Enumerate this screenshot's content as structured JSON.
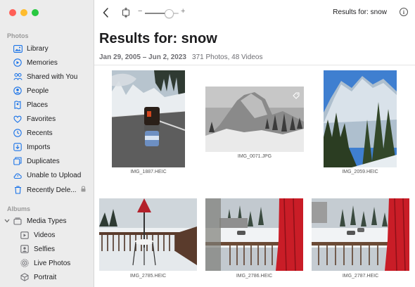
{
  "window_controls": {
    "close_color": "#ff5f57",
    "min_color": "#febc2e",
    "zoom_color": "#28c840"
  },
  "sidebar": {
    "photos_section": "Photos",
    "items": [
      {
        "label": "Library",
        "icon": "photo-library-icon"
      },
      {
        "label": "Memories",
        "icon": "memories-icon"
      },
      {
        "label": "Shared with You",
        "icon": "shared-with-you-icon"
      },
      {
        "label": "People",
        "icon": "people-icon"
      },
      {
        "label": "Places",
        "icon": "places-pin-icon"
      },
      {
        "label": "Favorites",
        "icon": "heart-icon"
      },
      {
        "label": "Recents",
        "icon": "recents-clock-icon"
      },
      {
        "label": "Imports",
        "icon": "imports-icon"
      },
      {
        "label": "Duplicates",
        "icon": "duplicates-icon"
      },
      {
        "label": "Unable to Upload",
        "icon": "cloud-alert-icon"
      },
      {
        "label": "Recently Dele...",
        "icon": "trash-icon",
        "locked": true
      }
    ],
    "albums_section": "Albums",
    "media_types": {
      "label": "Media Types",
      "icon": "album-stack-icon",
      "expanded": true
    },
    "media_children": [
      {
        "label": "Videos",
        "icon": "video-icon"
      },
      {
        "label": "Selfies",
        "icon": "selfie-icon"
      },
      {
        "label": "Live Photos",
        "icon": "live-photo-icon"
      },
      {
        "label": "Portrait",
        "icon": "portrait-cube-icon"
      }
    ]
  },
  "toolbar": {
    "title": "Results for: snow",
    "zoom_min": "−",
    "zoom_plus": "+",
    "zoom_level": 0.7,
    "info_glyph": "i"
  },
  "header": {
    "title": "Results for: snow",
    "date_range": "Jan 29, 2005 – Jun 2, 2023",
    "counts": "371 Photos, 48 Videos"
  },
  "photos": [
    {
      "file": "IMG_1887.HEIC"
    },
    {
      "file": "IMG_0071.JPG"
    },
    {
      "file": "IMG_2059.HEIC"
    },
    {
      "file": "IMG_2785.HEIC"
    },
    {
      "file": "IMG_2786.HEIC"
    },
    {
      "file": "IMG_2787.HEIC"
    }
  ],
  "accent": "#1a73e8"
}
